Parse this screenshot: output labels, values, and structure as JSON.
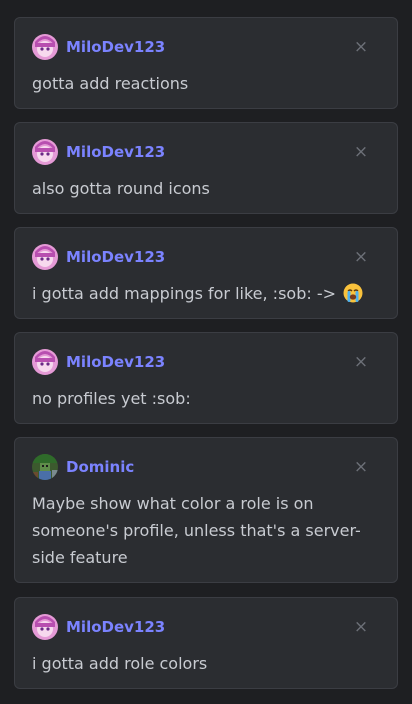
{
  "messages": [
    {
      "author": "MiloDev123",
      "avatar": "anime-avatar-icon",
      "text": "gotta add reactions",
      "close": "×"
    },
    {
      "author": "MiloDev123",
      "avatar": "anime-avatar-icon",
      "text": "also gotta round icons",
      "close": "×"
    },
    {
      "author": "MiloDev123",
      "avatar": "anime-avatar-icon",
      "text": "i gotta add mappings for like, :sob: ->",
      "emoji": "sob-emoji-icon",
      "close": "×"
    },
    {
      "author": "MiloDev123",
      "avatar": "anime-avatar-icon",
      "text": "no profiles yet :sob:",
      "close": "×"
    },
    {
      "author": "Dominic",
      "avatar": "minecraft-avatar-icon",
      "text": "Maybe show what color a role is on someone's profile, unless that's a server-side feature",
      "close": "×"
    },
    {
      "author": "MiloDev123",
      "avatar": "anime-avatar-icon",
      "text": "i gotta add role colors",
      "close": "×"
    }
  ],
  "colors": {
    "background": "#1e1f22",
    "card": "#2b2d31",
    "username": "#7b83ff",
    "text": "#c8cbd1"
  }
}
